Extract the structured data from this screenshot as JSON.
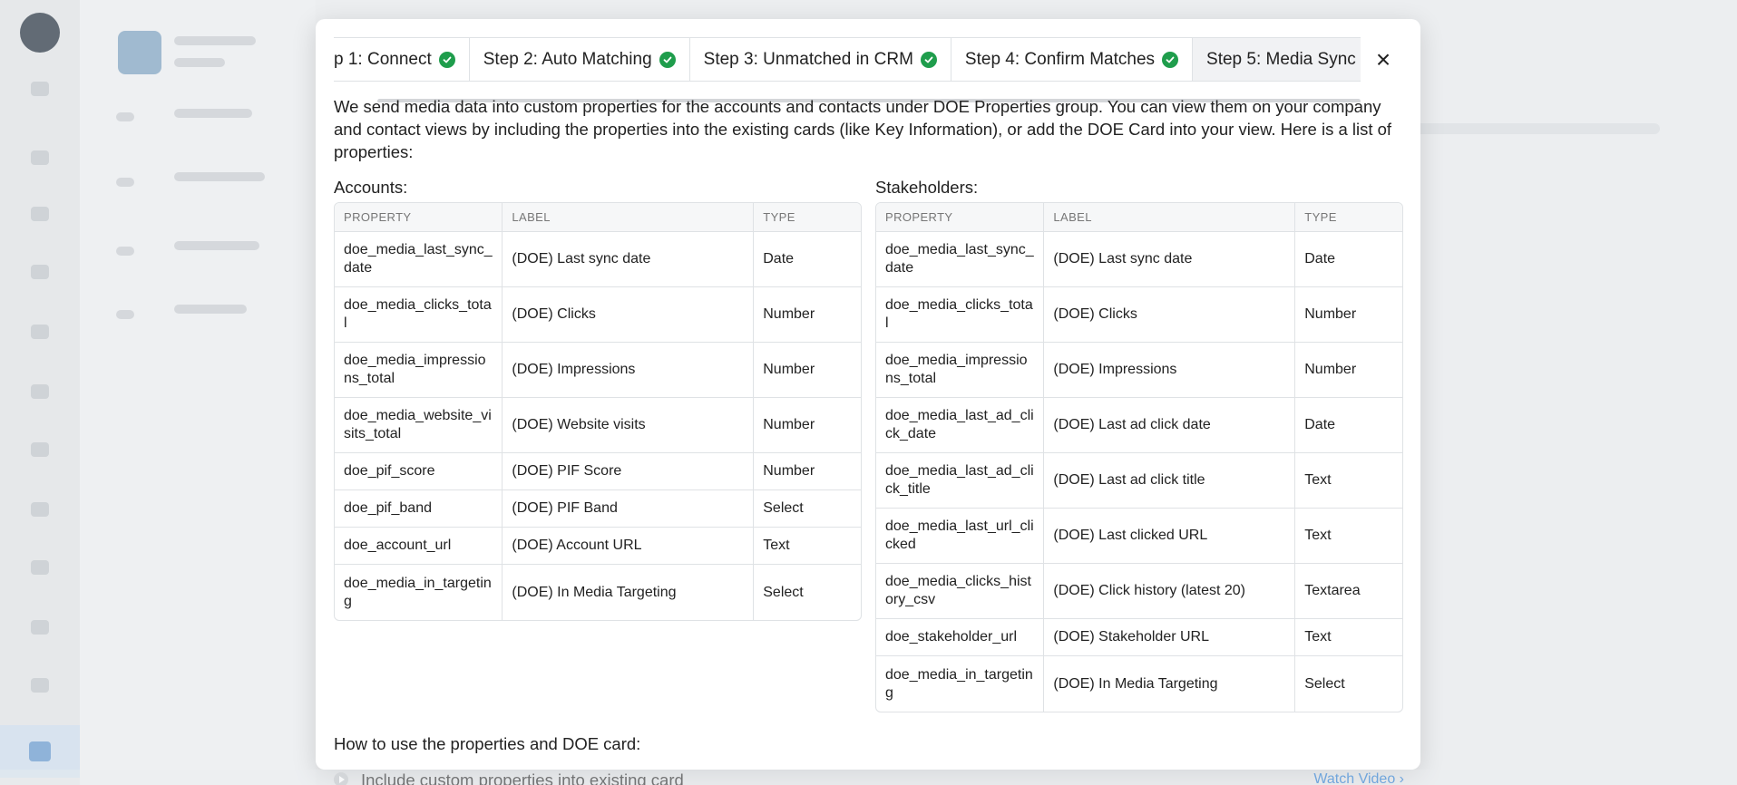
{
  "tabs": [
    {
      "label": "p 1: Connect",
      "done": true
    },
    {
      "label": "Step 2: Auto Matching",
      "done": true
    },
    {
      "label": "Step 3: Unmatched in CRM",
      "done": true
    },
    {
      "label": "Step 4: Confirm Matches",
      "done": true
    },
    {
      "label": "Step 5: Media Sync",
      "done": false
    }
  ],
  "close_label": "×",
  "intro": "We send media data into custom properties for the accounts and contacts under DOE Properties group. You can view them on your company and contact views by including the properties into the existing cards (like Key Information), or add the DOE Card into your view. Here is a list of properties:",
  "table_headers": {
    "property": "PROPERTY",
    "label": "LABEL",
    "type": "TYPE"
  },
  "accounts": {
    "title": "Accounts:",
    "rows": [
      {
        "property": "doe_media_last_sync_date",
        "label": "(DOE) Last sync date",
        "type": "Date"
      },
      {
        "property": "doe_media_clicks_total",
        "label": "(DOE) Clicks",
        "type": "Number"
      },
      {
        "property": "doe_media_impressions_total",
        "label": "(DOE) Impressions",
        "type": "Number"
      },
      {
        "property": "doe_media_website_visits_total",
        "label": "(DOE) Website visits",
        "type": "Number"
      },
      {
        "property": "doe_pif_score",
        "label": "(DOE) PIF Score",
        "type": "Number"
      },
      {
        "property": "doe_pif_band",
        "label": "(DOE) PIF Band",
        "type": "Select"
      },
      {
        "property": "doe_account_url",
        "label": "(DOE) Account URL",
        "type": "Text"
      },
      {
        "property": "doe_media_in_targeting",
        "label": "(DOE) In Media Targeting",
        "type": "Select"
      }
    ]
  },
  "stakeholders": {
    "title": "Stakeholders:",
    "rows": [
      {
        "property": "doe_media_last_sync_date",
        "label": "(DOE) Last sync date",
        "type": "Date"
      },
      {
        "property": "doe_media_clicks_total",
        "label": "(DOE) Clicks",
        "type": "Number"
      },
      {
        "property": "doe_media_impressions_total",
        "label": "(DOE) Impressions",
        "type": "Number"
      },
      {
        "property": "doe_media_last_ad_click_date",
        "label": "(DOE) Last ad click date",
        "type": "Date"
      },
      {
        "property": "doe_media_last_ad_click_title",
        "label": "(DOE) Last ad click title",
        "type": "Text"
      },
      {
        "property": "doe_media_last_url_clicked",
        "label": "(DOE) Last clicked URL",
        "type": "Text"
      },
      {
        "property": "doe_media_clicks_history_csv",
        "label": "(DOE) Click history (latest 20)",
        "type": "Textarea"
      },
      {
        "property": "doe_stakeholder_url",
        "label": "(DOE) Stakeholder URL",
        "type": "Text"
      },
      {
        "property": "doe_media_in_targeting",
        "label": "(DOE) In Media Targeting",
        "type": "Select"
      }
    ]
  },
  "how_to_title": "How to use the properties and DOE card:",
  "how_to_items": [
    {
      "text": "Include custom properties into existing card",
      "link": "Watch Video"
    }
  ],
  "colors": {
    "check": "#1f9d4c",
    "link": "#2f7fd1"
  }
}
